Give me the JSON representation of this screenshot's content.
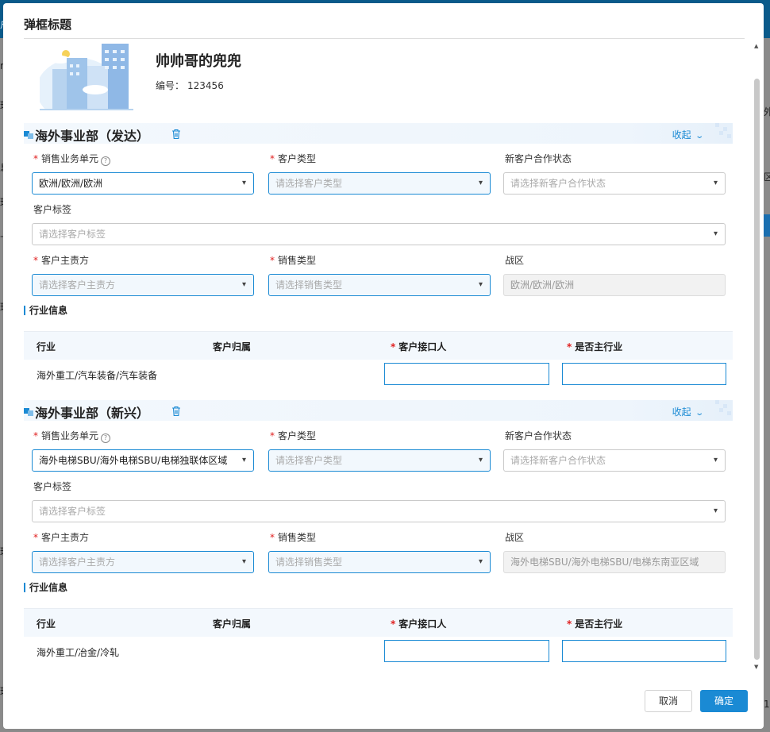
{
  "modal": {
    "title": "弹框标题",
    "cancel_label": "取消",
    "confirm_label": "确定"
  },
  "profile": {
    "name": "帅帅哥的兜兜",
    "number_label": "编号：",
    "number_value": "123456"
  },
  "sections": [
    {
      "title": "海外事业部（发达）",
      "collapse_label": "收起",
      "fields": {
        "sales_unit": {
          "label": "销售业务单元",
          "value": "欧洲/欧洲/欧洲"
        },
        "customer_type": {
          "label": "客户类型",
          "placeholder": "请选择客户类型"
        },
        "new_customer_status": {
          "label": "新客户合作状态",
          "placeholder": "请选择新客户合作状态"
        },
        "customer_tag": {
          "label": "客户标签",
          "placeholder": "请选择客户标签"
        },
        "customer_owner": {
          "label": "客户主责方",
          "placeholder": "请选择客户主责方"
        },
        "sales_type": {
          "label": "销售类型",
          "placeholder": "请选择销售类型"
        },
        "war_zone": {
          "label": "战区",
          "value": "欧洲/欧洲/欧洲"
        }
      },
      "industry": {
        "title": "行业信息",
        "columns": [
          "行业",
          "客户归属",
          "客户接口人",
          "是否主行业"
        ],
        "rows": [
          {
            "industry": "海外重工/汽车装备/汽车装备"
          }
        ]
      }
    },
    {
      "title": "海外事业部（新兴）",
      "collapse_label": "收起",
      "fields": {
        "sales_unit": {
          "label": "销售业务单元",
          "value": "海外电梯SBU/海外电梯SBU/电梯独联体区域"
        },
        "customer_type": {
          "label": "客户类型",
          "placeholder": "请选择客户类型"
        },
        "new_customer_status": {
          "label": "新客户合作状态",
          "placeholder": "请选择新客户合作状态"
        },
        "customer_tag": {
          "label": "客户标签",
          "placeholder": "请选择客户标签"
        },
        "customer_owner": {
          "label": "客户主责方",
          "placeholder": "请选择客户主责方"
        },
        "sales_type": {
          "label": "销售类型",
          "placeholder": "请选择销售类型"
        },
        "war_zone": {
          "label": "战区",
          "value": "海外电梯SBU/海外电梯SBU/电梯东南亚区域"
        }
      },
      "industry": {
        "title": "行业信息",
        "columns": [
          "行业",
          "客户归属",
          "客户接口人",
          "是否主行业"
        ],
        "rows": [
          {
            "industry": "海外重工/冶金/冷轧"
          }
        ]
      }
    }
  ],
  "background_fragments": [
    "户",
    "r",
    "外",
    "理",
    "息",
    "理",
    "十",
    "理",
    "区",
    "理",
    "理",
    "1"
  ],
  "colors": {
    "accent": "#1a8ad4",
    "required": "#e02020",
    "header_bg": "#f3f8fd"
  },
  "icons": [
    "question-circle-icon",
    "trash-icon",
    "chevron-down-icon",
    "section-square-icon"
  ]
}
